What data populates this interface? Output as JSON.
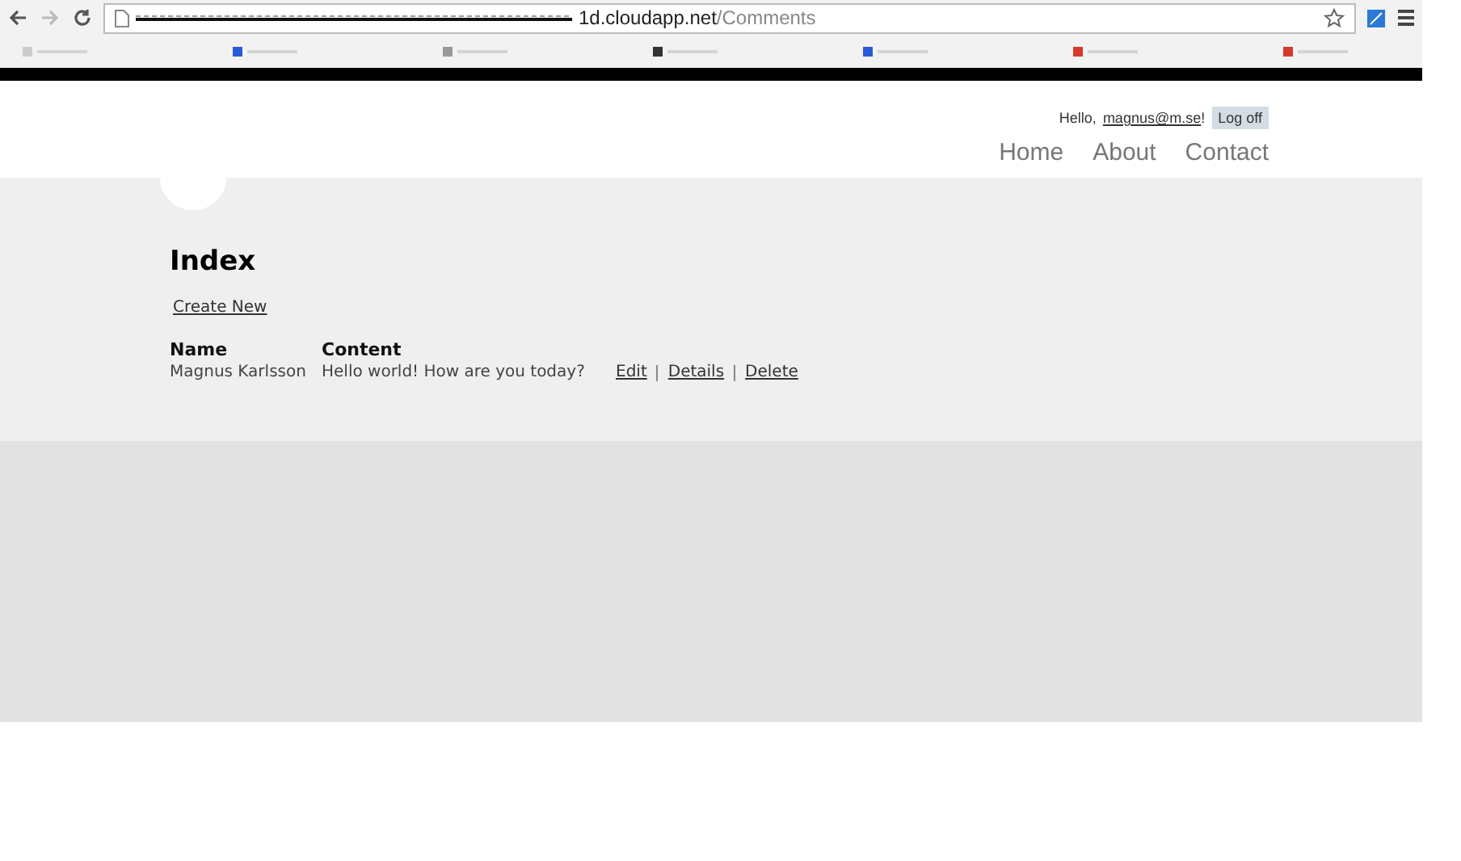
{
  "browser": {
    "url_host": "1d.cloudapp.net",
    "url_path": "/Comments"
  },
  "header": {
    "greeting": "Hello,",
    "user": "magnus@m.se",
    "exclaim": "!",
    "logoff": "Log off",
    "nav": [
      "Home",
      "About",
      "Contact"
    ]
  },
  "page": {
    "title": "Index",
    "create_link": "Create New",
    "table": {
      "columns": [
        "Name",
        "Content"
      ],
      "rows": [
        {
          "cells": [
            "Magnus Karlsson",
            "Hello world! How are you today?"
          ],
          "actions": [
            "Edit",
            "Details",
            "Delete"
          ]
        }
      ]
    }
  }
}
